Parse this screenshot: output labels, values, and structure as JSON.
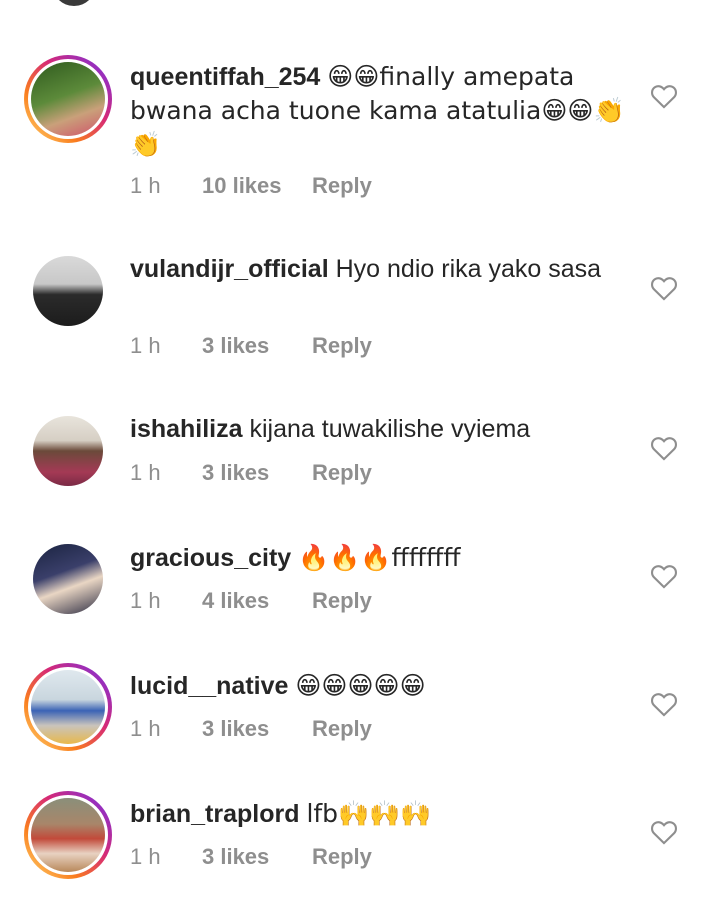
{
  "comments": [
    {
      "username": "queentiffah_254",
      "text": "😁😁finally amepata bwana acha tuone kama atatulia😁😁👏👏",
      "time": "1 h",
      "likes": "10 likes",
      "reply": "Reply",
      "story_ring": true
    },
    {
      "username": "vulandijr_official",
      "text": "Hyo ndio rika yako sasa",
      "time": "1 h",
      "likes": "3 likes",
      "reply": "Reply",
      "story_ring": false
    },
    {
      "username": "ishahiliza",
      "text": "kijana tuwakilishe vyiema",
      "time": "1 h",
      "likes": "3 likes",
      "reply": "Reply",
      "story_ring": false
    },
    {
      "username": "gracious_city",
      "text": "🔥🔥🔥ffffffff",
      "time": "1 h",
      "likes": "4 likes",
      "reply": "Reply",
      "story_ring": false
    },
    {
      "username": "lucid__native",
      "text": "😁😁😁😁😁",
      "time": "1 h",
      "likes": "3 likes",
      "reply": "Reply",
      "story_ring": true
    },
    {
      "username": "brian_traplord",
      "text": "lfb🙌🙌🙌",
      "time": "1 h",
      "likes": "3 likes",
      "reply": "Reply",
      "story_ring": true
    }
  ],
  "colors": {
    "text": "#262626",
    "meta": "#8e8e8e",
    "heart_outline": "#8e8e8e"
  },
  "icons": {
    "like": "heart-outline-icon"
  }
}
